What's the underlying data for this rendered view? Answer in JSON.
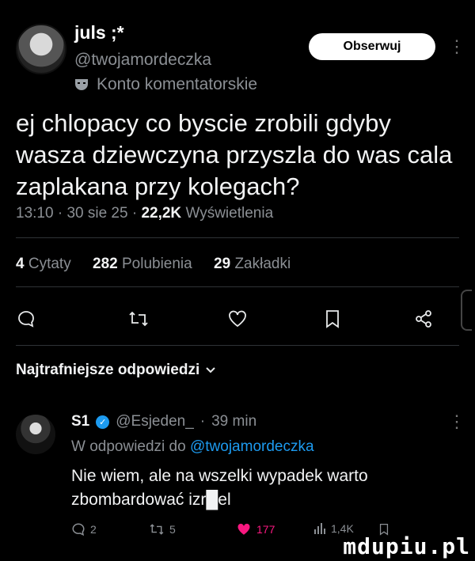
{
  "author": {
    "display_name": "juls ;*",
    "handle": "@twojamordeczka",
    "account_type": "Konto komentatorskie",
    "follow_label": "Obserwuj",
    "more_label": "⋮"
  },
  "tweet": {
    "text": "ej chlopacy co byscie zrobili gdyby wasza dziewczyna przyszla do was cala zaplakana przy kolegach?",
    "time": "13:10",
    "date": "30 sie 25",
    "views_count": "22,2K",
    "views_label": "Wyświetlenia"
  },
  "stats": {
    "quotes_count": "4",
    "quotes_label": "Cytaty",
    "likes_count": "282",
    "likes_label": "Polubienia",
    "bookmarks_count": "29",
    "bookmarks_label": "Zakładki"
  },
  "top_replies_label": "Najtrafniejsze odpowiedzi",
  "reply": {
    "name": "S1",
    "handle": "@Esjeden_",
    "time": "39 min",
    "context_prefix": "W odpowiedzi do",
    "context_handle": "@twojamordeczka",
    "text": "Nie wiem, ale na wszelki wypadek warto zbombardować izr█el",
    "replies": "2",
    "reposts": "5",
    "likes": "177",
    "views": "1,4K"
  },
  "watermark": "mdupiu.pl",
  "colors": {
    "accent": "#1d9bf0",
    "like": "#f91880",
    "background": "#000000"
  }
}
